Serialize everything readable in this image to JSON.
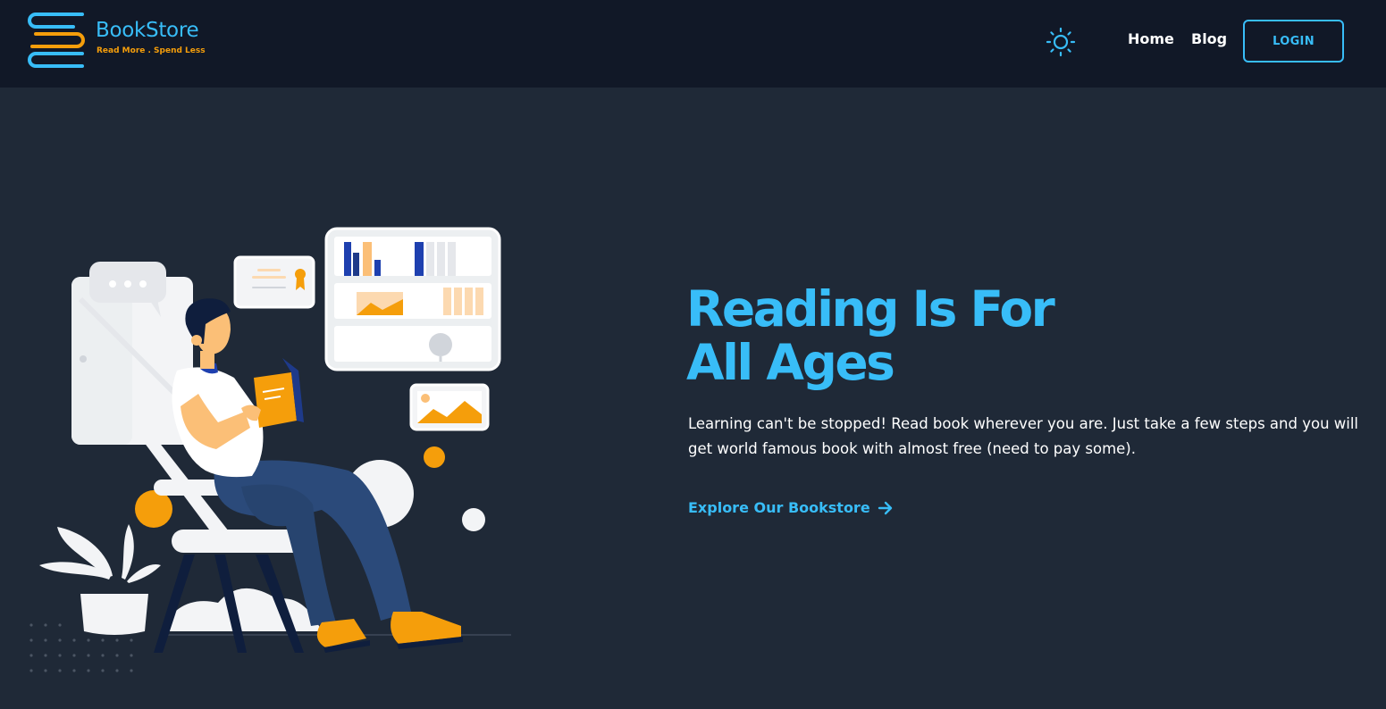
{
  "brand": {
    "name": "BookStore",
    "tagline": "Read More . Spend Less"
  },
  "header": {
    "theme_toggle_icon": "sun-icon",
    "nav": [
      {
        "label": "Home"
      },
      {
        "label": "Blog"
      }
    ],
    "login_label": "LOGIN"
  },
  "hero": {
    "title_line1": "Reading Is For",
    "title_line2": "All Ages",
    "description": "Learning can't be stopped! Read book wherever you are. Just take a few steps and you will get world famous book with almost free (need to pay some).",
    "cta_label": "Explore Our Bookstore",
    "cta_icon": "arrow-right-icon",
    "illustration": "person-reading-book-in-chair"
  },
  "colors": {
    "accent": "#38bdf8",
    "orange": "#f59e0b",
    "nav_bg": "#111827",
    "page_bg": "#1f2937"
  }
}
